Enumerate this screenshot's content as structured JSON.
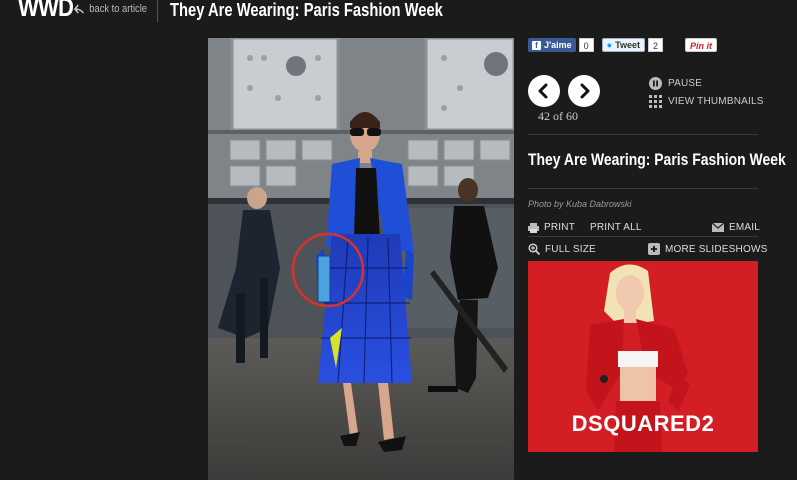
{
  "header": {
    "logo": "WWD",
    "back_label": "back to article",
    "title": "They Are Wearing: Paris Fashion  Week"
  },
  "social": {
    "facebook_label": "J'aime",
    "facebook_count": "0",
    "tweet_label": "Tweet",
    "tweet_count": "2",
    "pin_label": "Pin it"
  },
  "slideshow": {
    "counter": "42 of 60",
    "pause_label": "PAUSE",
    "thumbnails_label": "VIEW THUMBNAILS",
    "title": "They Are Wearing: Paris Fashion Week",
    "credit": "Photo by Kuba Dabrowski"
  },
  "actions": {
    "print": "PRINT",
    "print_all": "PRINT ALL",
    "email": "EMAIL",
    "full_size": "FULL SIZE",
    "more_slideshows": "MORE SLIDESHOWS"
  },
  "ad": {
    "brand": "DSQUARED2"
  },
  "colors": {
    "background": "#1b1b1b",
    "ad_red": "#d21e24",
    "facebook_blue": "#3b5998",
    "annotation_circle": "#d8322a"
  }
}
